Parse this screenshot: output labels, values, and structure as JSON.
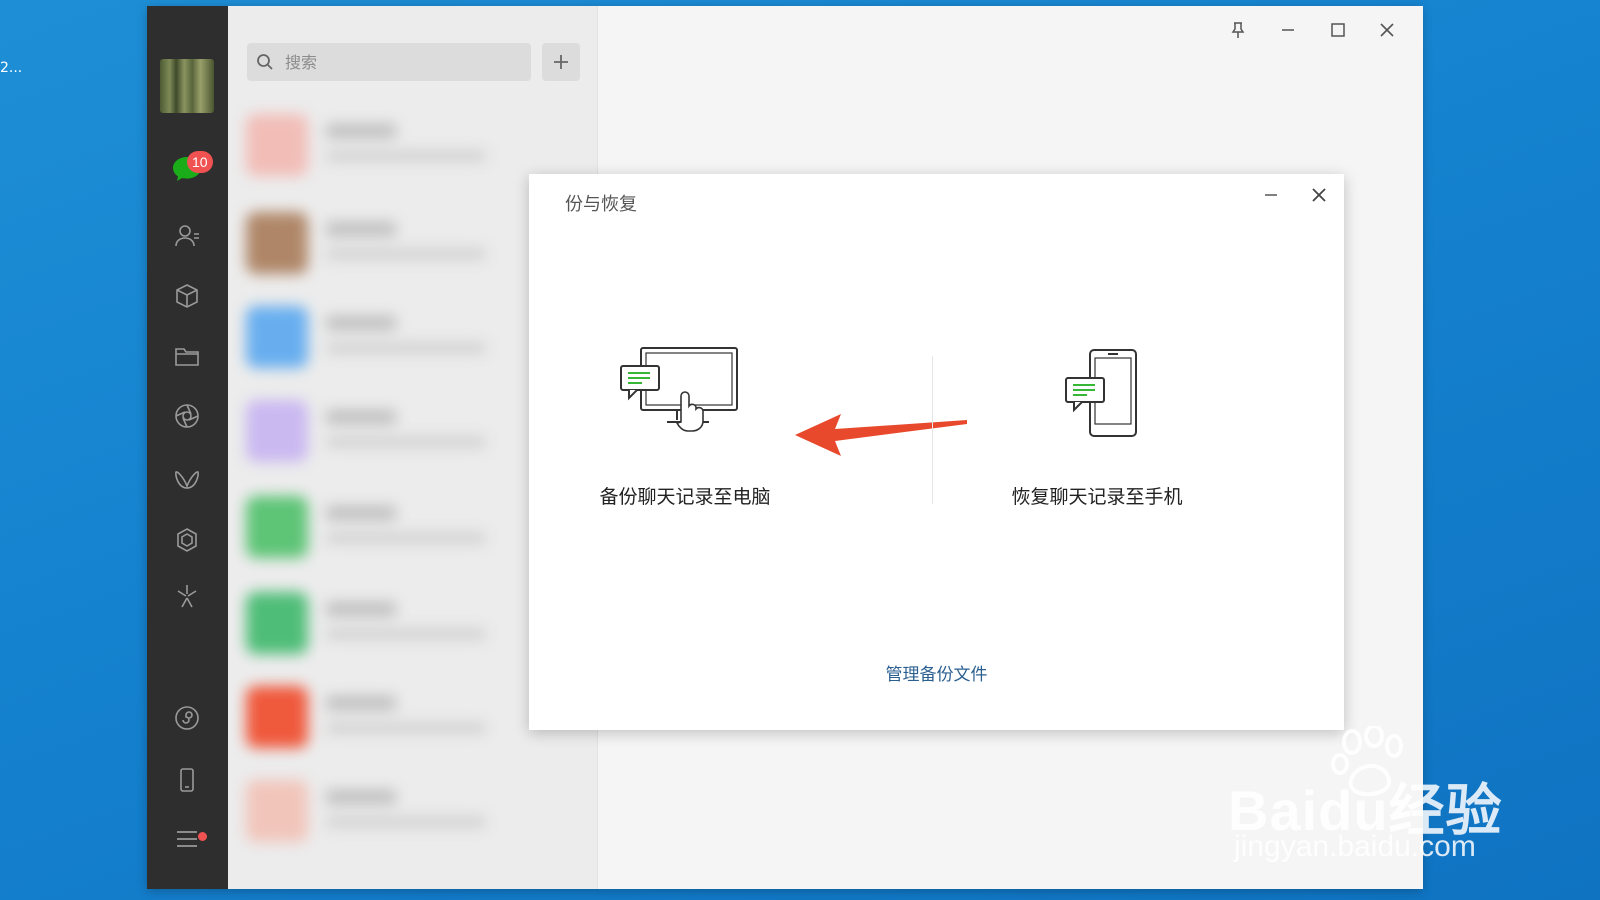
{
  "desktop": {
    "label": "2..."
  },
  "sidebar": {
    "unread_badge": "10"
  },
  "search": {
    "placeholder": "搜索"
  },
  "dialog": {
    "title": "份与恢复",
    "backup_option_label": "备份聊天记录至电脑",
    "restore_option_label": "恢复聊天记录至手机",
    "manage_link": "管理备份文件"
  },
  "watermark": {
    "main": "Baidu经验",
    "sub": "jingyan.baidu.com"
  },
  "colors": {
    "nav_bg": "#2e2e2e",
    "badge": "#f05252",
    "accent_green": "#1aad19",
    "arrow": "#e8492c",
    "link": "#2b5f91"
  },
  "icons": [
    "search-icon",
    "plus-icon",
    "chat-icon",
    "contacts-icon",
    "cube-icon",
    "folder-icon",
    "aperture-icon",
    "butterfly-icon",
    "hexagon-icon",
    "sparkle-icon",
    "mini-program-icon",
    "phone-icon",
    "menu-icon",
    "pin-icon",
    "minimize-icon",
    "maximize-icon",
    "close-icon"
  ]
}
